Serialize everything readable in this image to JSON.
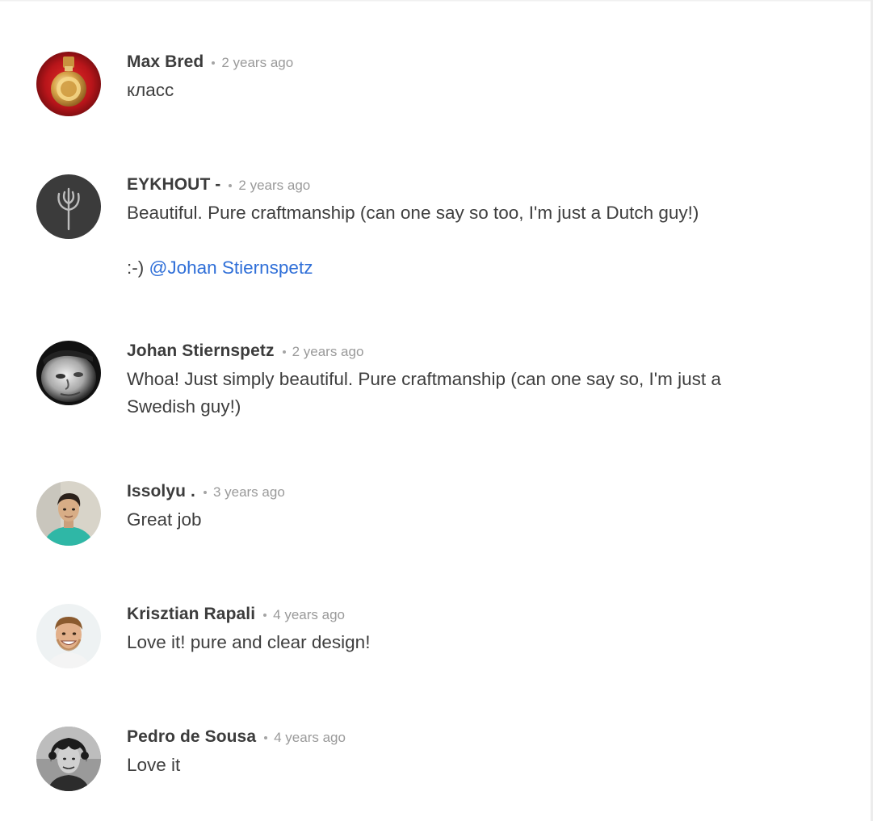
{
  "comments": [
    {
      "author": "Max Bred",
      "time": "2 years ago",
      "text": "класс",
      "avatar": "perfume-bottle-avatar"
    },
    {
      "author": "EYKHOUT -",
      "time": "2 years ago",
      "text": "Beautiful. Pure craftmanship (can one say so too, I'm just a Dutch guy!)",
      "text2_prefix": ":-) ",
      "mention": "@Johan Stiernspetz",
      "avatar": "tree-logo-avatar"
    },
    {
      "author": "Johan Stiernspetz",
      "time": "2 years ago",
      "text": "Whoa! Just simply beautiful. Pure craftmanship (can one say so, I'm just a Swedish guy!)",
      "avatar": "bw-portrait-avatar"
    },
    {
      "author": "Issolyu .",
      "time": "3 years ago",
      "text": "Great job",
      "avatar": "man-teal-shirt-avatar"
    },
    {
      "author": "Krisztian Rapali",
      "time": "4 years ago",
      "text": "Love it! pure and clear design!",
      "avatar": "smiling-man-avatar"
    },
    {
      "author": "Pedro de Sousa",
      "time": "4 years ago",
      "text": "Love it",
      "avatar": "curly-hair-bw-avatar"
    }
  ],
  "colors": {
    "author": "#3c3c3c",
    "time": "#9a9a9a",
    "text": "#3e3e3e",
    "mention": "#2f6fd8"
  }
}
